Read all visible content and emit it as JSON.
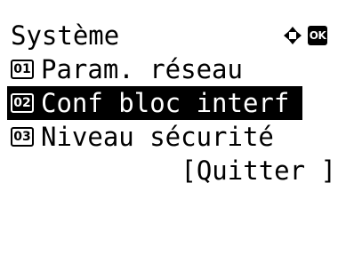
{
  "screen": {
    "title": "Système",
    "nav_icon": "four-way-arrow-icon",
    "ok_label": "OK"
  },
  "menu": {
    "items": [
      {
        "number": "01",
        "label": "Param. réseau",
        "selected": false
      },
      {
        "number": "02",
        "label": "Conf bloc interf",
        "selected": true
      },
      {
        "number": "03",
        "label": "Niveau sécurité",
        "selected": false
      }
    ]
  },
  "footer": {
    "quit_label": "[Quitter ]"
  }
}
